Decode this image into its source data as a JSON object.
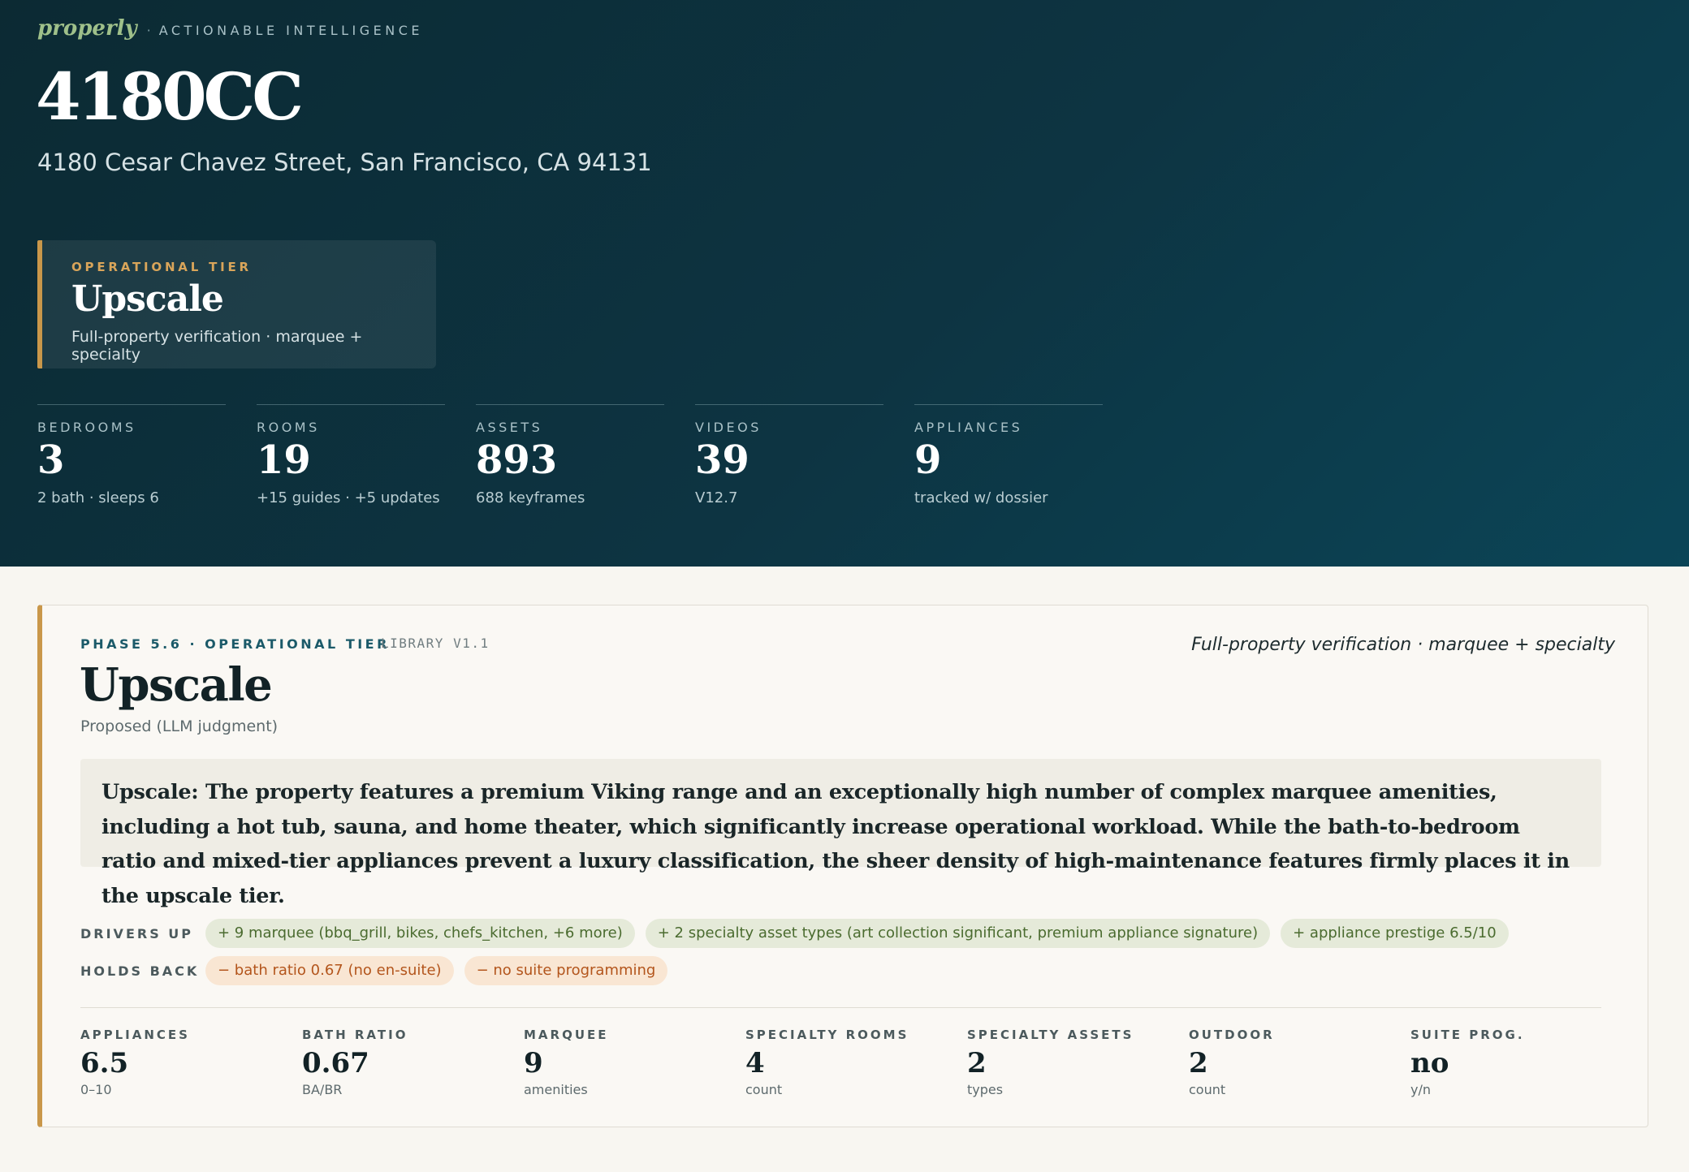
{
  "header": {
    "brand": "properly",
    "separator": "·",
    "tagline": "ACTIONABLE INTELLIGENCE",
    "title": "4180CC",
    "address": "4180 Cesar Chavez Street, San Francisco, CA 94131"
  },
  "tier_card": {
    "label": "OPERATIONAL TIER",
    "name": "Upscale",
    "description": "Full-property verification · marquee + specialty"
  },
  "stats": [
    {
      "label": "BEDROOMS",
      "value": "3",
      "sub": "2 bath · sleeps 6"
    },
    {
      "label": "ROOMS",
      "value": "19",
      "sub": "+15 guides · +5 updates"
    },
    {
      "label": "ASSETS",
      "value": "893",
      "sub": "688 keyframes"
    },
    {
      "label": "VIDEOS",
      "value": "39",
      "sub": "V12.7"
    },
    {
      "label": "APPLIANCES",
      "value": "9",
      "sub": "tracked w/ dossier"
    }
  ],
  "panel": {
    "phase_label": "PHASE 5.6 · OPERATIONAL TIER",
    "library_label": "LIBRARY V1.1",
    "tier_description": "Full-property verification · marquee + specialty",
    "title": "Upscale",
    "proposed": "Proposed (LLM judgment)",
    "rationale": "Upscale: The property features a premium Viking range and an exceptionally high number of complex marquee amenities, including a hot tub, sauna, and home theater, which significantly increase operational workload. While the bath-to-bedroom ratio and mixed-tier appliances prevent a luxury classification, the sheer density of high-maintenance features firmly places it in the upscale tier.",
    "drivers_up_label": "DRIVERS UP",
    "drivers_up": [
      "+ 9 marquee (bbq_grill, bikes, chefs_kitchen, +6 more)",
      "+ 2 specialty asset types (art collection significant, premium appliance signature)",
      "+ appliance prestige 6.5/10"
    ],
    "holds_back_label": "HOLDS BACK",
    "holds_back": [
      "− bath ratio 0.67 (no en-suite)",
      "− no suite programming"
    ],
    "metrics": [
      {
        "label": "APPLIANCES",
        "value": "6.5",
        "unit": "0–10"
      },
      {
        "label": "BATH RATIO",
        "value": "0.67",
        "unit": "BA/BR"
      },
      {
        "label": "MARQUEE",
        "value": "9",
        "unit": "amenities"
      },
      {
        "label": "SPECIALTY ROOMS",
        "value": "4",
        "unit": "count"
      },
      {
        "label": "SPECIALTY ASSETS",
        "value": "2",
        "unit": "types"
      },
      {
        "label": "OUTDOOR",
        "value": "2",
        "unit": "count"
      },
      {
        "label": "SUITE PROG.",
        "value": "no",
        "unit": "y/n"
      }
    ]
  },
  "colors": {
    "hero_dark": "#0c2a33",
    "hero_teal": "#0b4557",
    "accent_gold": "#c9974a",
    "brand_green": "#9fc08a",
    "chip_up_bg": "#e5ead9",
    "chip_up_text": "#4a6b2f",
    "chip_down_bg": "#f9e6d3",
    "chip_down_text": "#b3551c"
  }
}
